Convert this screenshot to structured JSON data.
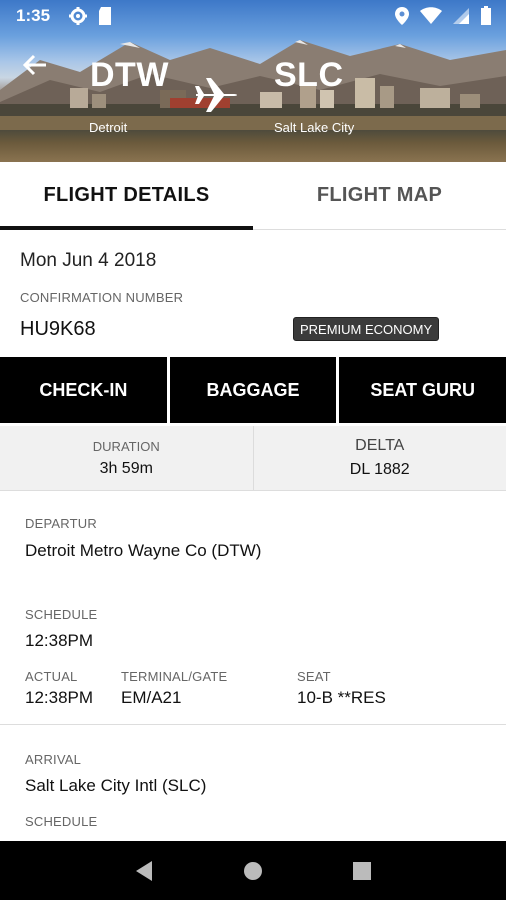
{
  "status_bar": {
    "time": "1:35",
    "icons": [
      "settings-gear-icon",
      "sd-card-icon",
      "location-pin-icon",
      "wifi-icon",
      "cell-signal-icon",
      "battery-icon"
    ]
  },
  "header": {
    "origin_code": "DTW",
    "origin_city": "Detroit",
    "destination_code": "SLC",
    "destination_city": "Salt Lake City"
  },
  "tabs": [
    {
      "label": "FLIGHT DETAILS",
      "active": true
    },
    {
      "label": "FLIGHT MAP",
      "active": false
    }
  ],
  "trip": {
    "date": "Mon Jun 4 2018",
    "confirmation_label": "CONFIRMATION NUMBER",
    "confirmation_number": "HU9K68",
    "cabin_class": "PREMIUM ECONOMY"
  },
  "actions": [
    "CHECK-IN",
    "BAGGAGE",
    "SEAT GURU"
  ],
  "summary": {
    "duration_label": "DURATION",
    "duration_value": "3h 59m",
    "airline": "DELTA",
    "flight_number": "DL 1882"
  },
  "departure": {
    "label": "DEPARTUR",
    "airport": "Detroit Metro Wayne Co (DTW)",
    "schedule_label": "SCHEDULE",
    "schedule_time": "12:38PM",
    "actual_label": "ACTUAL",
    "actual_time": "12:38PM",
    "gate_label": "TERMINAL/GATE",
    "gate_value": "EM/A21",
    "seat_label": "SEAT",
    "seat_value": "10-B **RES"
  },
  "arrival": {
    "label": "ARRIVAL",
    "airport": "Salt Lake City Intl (SLC)",
    "schedule_label": "SCHEDULE"
  },
  "colors": {
    "action_bg": "#000000",
    "badge_bg": "#3b3b3b",
    "summary_bg": "#f1f1f1"
  }
}
